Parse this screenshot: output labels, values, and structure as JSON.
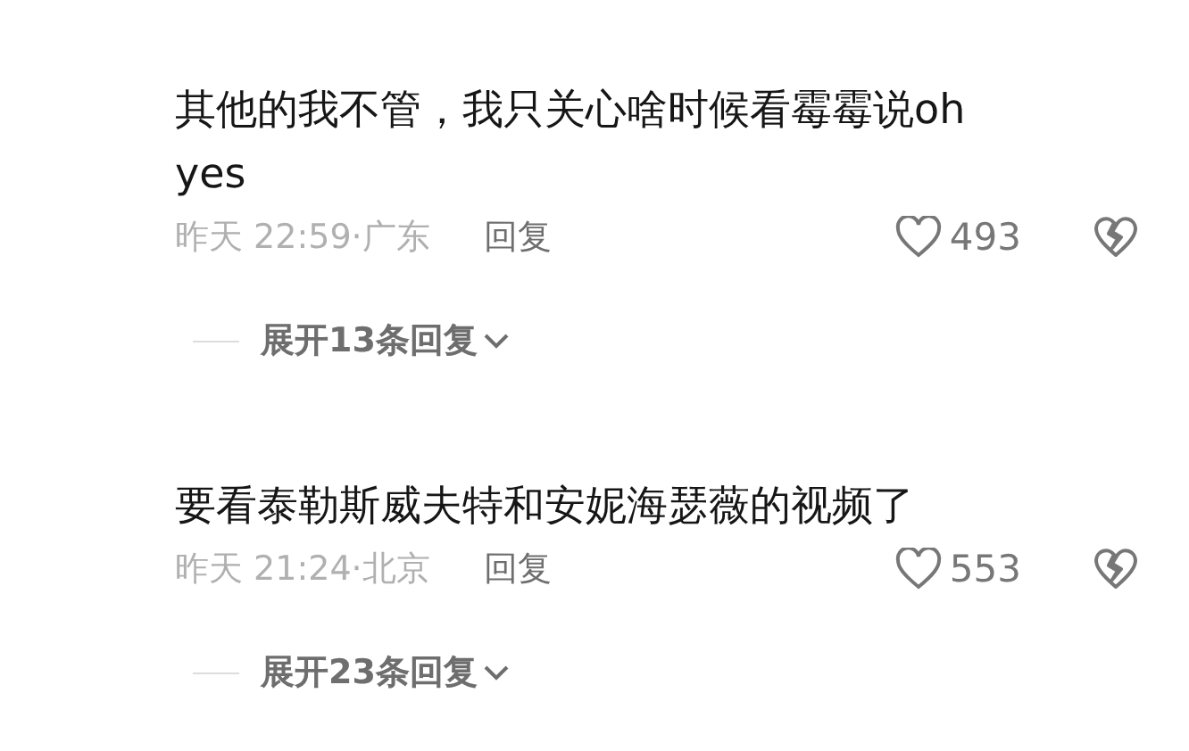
{
  "comments": [
    {
      "text": "其他的我不管，我只关心啥时候看霉霉说oh yes",
      "time": "昨天 22:59·广东",
      "reply": "回复",
      "likes": "493",
      "expand": "展开13条回复"
    },
    {
      "text": "要看泰勒斯威夫特和安妮海瑟薇的视频了",
      "time": "昨天 21:24·北京",
      "reply": "回复",
      "likes": "553",
      "expand": "展开23条回复"
    }
  ]
}
